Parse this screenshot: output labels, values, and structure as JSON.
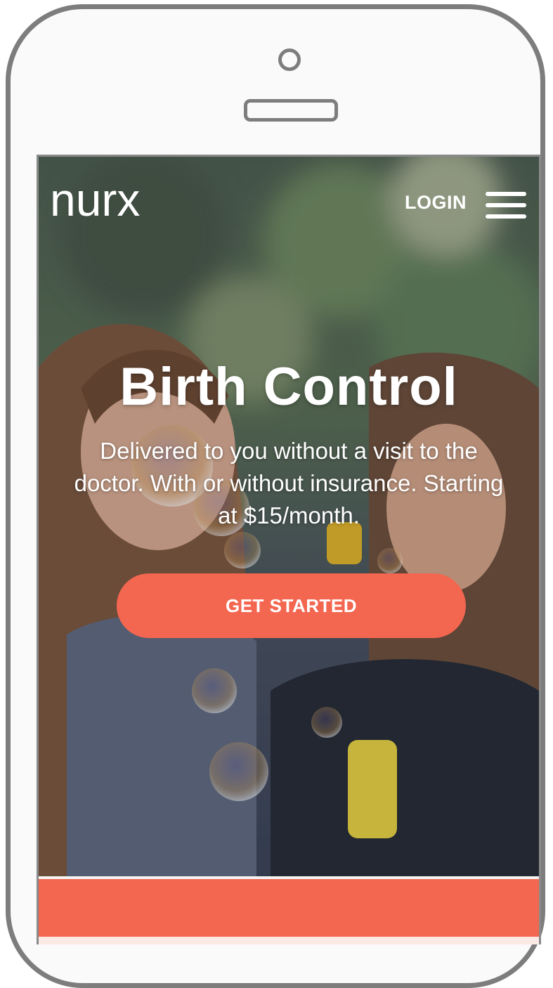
{
  "brand": {
    "logo_text": "nurx",
    "accent_color": "#f36650"
  },
  "header": {
    "login_label": "LOGIN",
    "menu_icon": "hamburger-menu-icon"
  },
  "hero": {
    "title": "Birth Control",
    "subtitle": "Delivered to you without a visit to the doctor. With or without insurance. Starting at $15/month.",
    "cta_label": "GET STARTED"
  }
}
